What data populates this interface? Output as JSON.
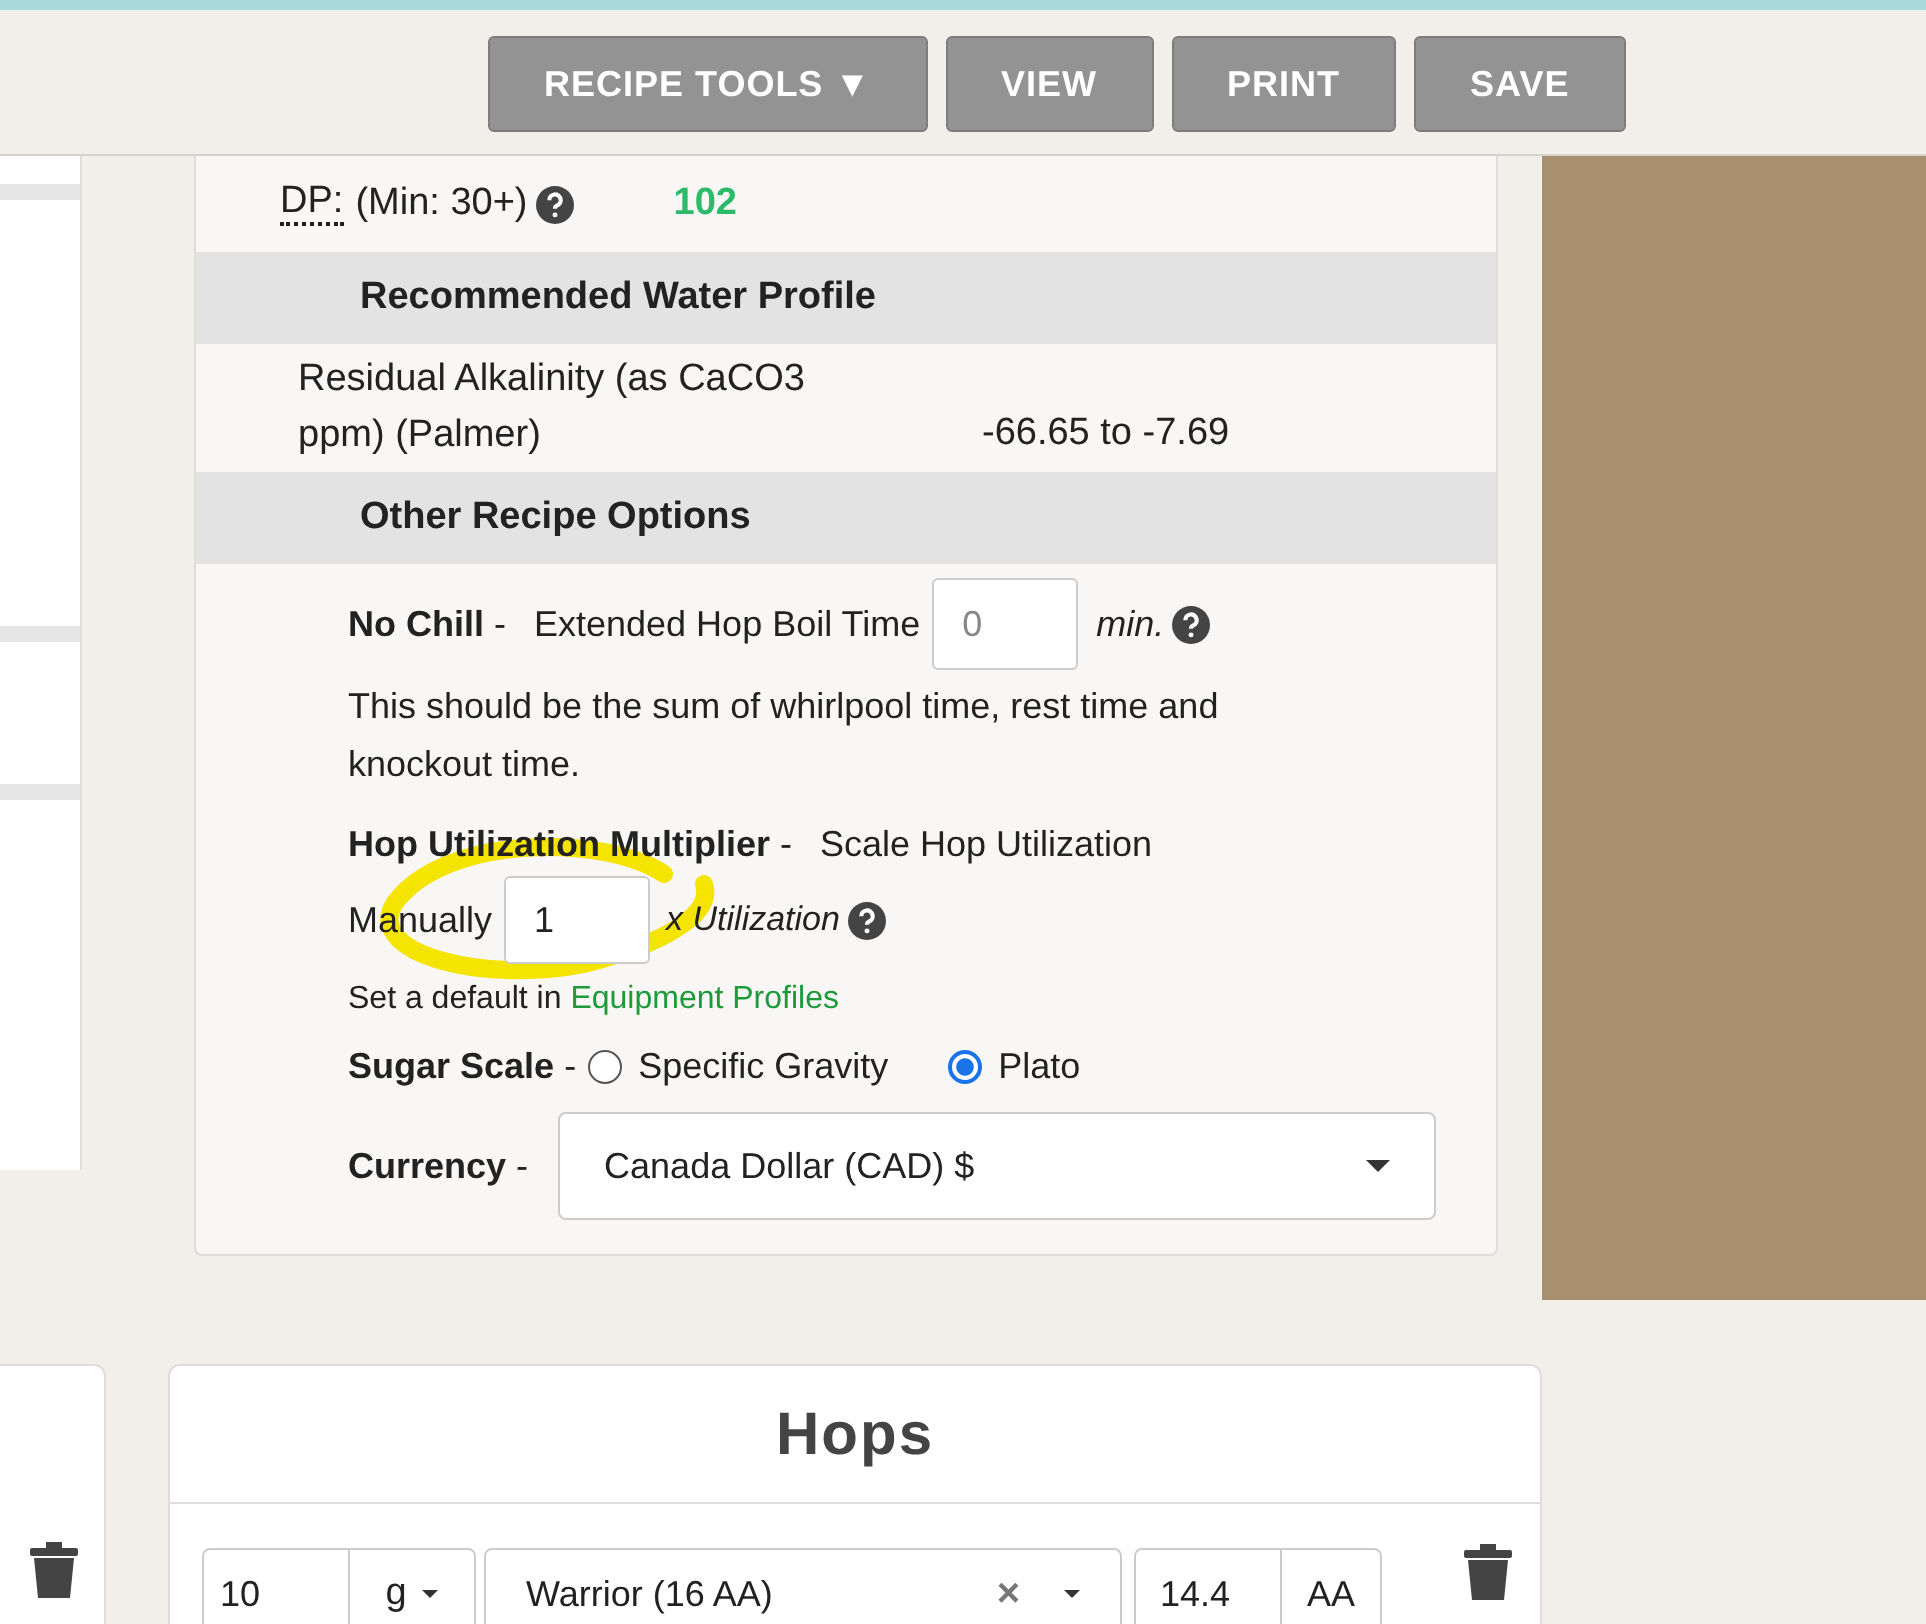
{
  "toolbar": {
    "buttons": [
      {
        "label": "RECIPE TOOLS ▼"
      },
      {
        "label": "VIEW"
      },
      {
        "label": "PRINT"
      },
      {
        "label": "SAVE"
      }
    ]
  },
  "stats": {
    "label": "DP:",
    "hint": "(Min: 30+)",
    "value": "102"
  },
  "water_profile": {
    "heading": "Recommended Water Profile",
    "label": "Residual Alkalinity (as CaCO3 ppm) (Palmer)",
    "value": "-66.65 to -7.69"
  },
  "options": {
    "heading": "Other Recipe Options",
    "no_chill": {
      "label": "No Chill",
      "separator": "-",
      "text": "Extended Hop Boil Time",
      "placeholder": "0",
      "unit": "min.",
      "note": "This should be the sum of whirlpool time, rest time and knockout time."
    },
    "hop_utilization": {
      "label": "Hop Utilization Multiplier",
      "separator": "-",
      "text_lines": [
        "Scale Hop Utilization",
        "Manually"
      ],
      "value": "1",
      "unit": "x Utilization",
      "note": "Set a default in",
      "link": "Equipment Profiles"
    },
    "sugar_scale": {
      "label": "Sugar Scale",
      "separator": "-",
      "choices": [
        {
          "label": "Specific Gravity",
          "selected": false
        },
        {
          "label": "Plato",
          "selected": true
        }
      ]
    },
    "currency": {
      "label": "Currency",
      "separator": "-",
      "value": "Canada Dollar (CAD) $"
    }
  },
  "hops": {
    "title": "Hops",
    "rows": [
      {
        "amount": "10",
        "unit": "g",
        "variety": "Warrior (16 AA)",
        "clear": "×",
        "alpha": "14.4",
        "alpha_unit": "AA"
      }
    ]
  }
}
